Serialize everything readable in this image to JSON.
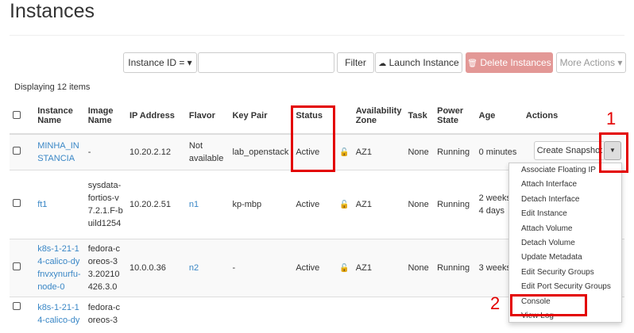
{
  "page": {
    "title": "Instances"
  },
  "toolbar": {
    "filter_select": "Instance ID = ▾",
    "filter_value": "",
    "filter_button": "Filter",
    "launch_button": "Launch Instance",
    "delete_button": "Delete Instances",
    "more_actions": "More Actions ▾"
  },
  "display_count": "Displaying 12 items",
  "table": {
    "headers": {
      "name": "Instance Name",
      "image": "Image Name",
      "ip": "IP Address",
      "flavor": "Flavor",
      "keypair": "Key Pair",
      "status": "Status",
      "az": "Availability Zone",
      "task": "Task",
      "power": "Power State",
      "age": "Age",
      "actions": "Actions"
    },
    "rows": [
      {
        "name": "MINHA_INSTANCIA",
        "image": "-",
        "ip": "10.20.2.12",
        "flavor": "Not available",
        "keypair": "lab_openstack",
        "status": "Active",
        "az": "AZ1",
        "task": "None",
        "power": "Running",
        "age": "0 minutes",
        "action": "Create Snapshot"
      },
      {
        "name": "ft1",
        "image": "sysdata-fortios-v7.2.1.F-build1254",
        "ip": "10.20.2.51",
        "flavor": "n1",
        "keypair": "kp-mbp",
        "status": "Active",
        "az": "AZ1",
        "task": "None",
        "power": "Running",
        "age": "2 weeks, 4 days"
      },
      {
        "name": "k8s-1-21-14-calico-dyfnvxynurfu-node-0",
        "image": "fedora-coreos-33.20210426.3.0",
        "ip": "10.0.0.36",
        "flavor": "n2",
        "keypair": "-",
        "status": "Active",
        "az": "AZ1",
        "task": "None",
        "power": "Running",
        "age": "3 weeks"
      },
      {
        "name": "k8s-1-21-14-calico-dy",
        "image": "fedora-coreos-3"
      }
    ]
  },
  "dropdown_menu": [
    "Associate Floating IP",
    "Attach Interface",
    "Detach Interface",
    "Edit Instance",
    "Attach Volume",
    "Detach Volume",
    "Update Metadata",
    "Edit Security Groups",
    "Edit Port Security Groups",
    "Console",
    "View Log"
  ],
  "annotations": {
    "marker_1": "1",
    "marker_2": "2"
  },
  "colors": {
    "link": "#3a87c6",
    "danger_button": "#e39896",
    "annotation_red": "#e30000"
  }
}
